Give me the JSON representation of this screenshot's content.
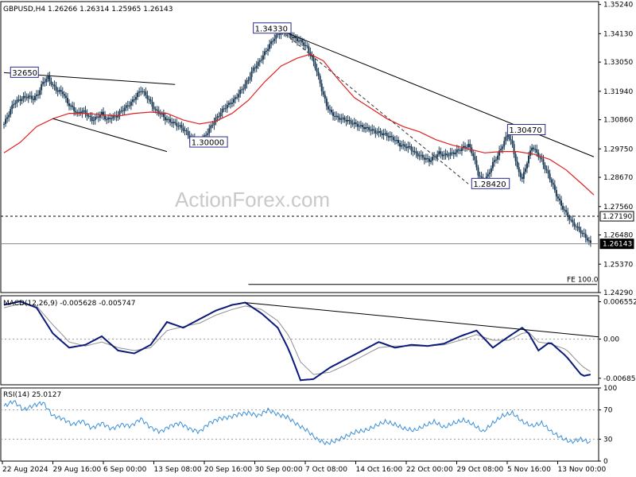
{
  "header": {
    "symbol": "GBPUSD,H4",
    "ohlc": "1.26266 1.26314 1.25965 1.26143"
  },
  "watermark": "ActionForex.com",
  "colors": {
    "candle": "#1b3a55",
    "ema": "#e02020",
    "trendline": "#000000",
    "macd": "#0a1a7a",
    "signal": "#909090",
    "rsi": "#3a8fd8",
    "grid": "#999999"
  },
  "chart_data": [
    {
      "type": "line",
      "name": "price",
      "title": "GBPUSD,H4",
      "ylim": [
        1.2429,
        1.3535
      ],
      "y_ticks": [
        "1.35240",
        "1.34130",
        "1.33050",
        "1.31940",
        "1.30860",
        "1.29750",
        "1.28670",
        "1.27560",
        "1.26480",
        "1.25370",
        "1.24290"
      ],
      "x_ticks": [
        "22 Aug 2024",
        "29 Aug 16:00",
        "6 Sep 00:00",
        "13 Sep 08:00",
        "20 Sep 16:00",
        "30 Sep 00:00",
        "7 Oct 08:00",
        "14 Oct 16:00",
        "22 Oct 00:00",
        "29 Oct 08:00",
        "5 Nov 16:00",
        "13 Nov 00:00"
      ],
      "close_series": [
        [
          0,
          1.307
        ],
        [
          3,
          1.311
        ],
        [
          6,
          1.315
        ],
        [
          9,
          1.316
        ],
        [
          12,
          1.317
        ],
        [
          15,
          1.3175
        ],
        [
          18,
          1.3165
        ],
        [
          21,
          1.3185
        ],
        [
          24,
          1.323
        ],
        [
          27,
          1.3245
        ],
        [
          30,
          1.3215
        ],
        [
          33,
          1.3195
        ],
        [
          36,
          1.319
        ],
        [
          39,
          1.315
        ],
        [
          42,
          1.313
        ],
        [
          45,
          1.311
        ],
        [
          48,
          1.312
        ],
        [
          51,
          1.3105
        ],
        [
          54,
          1.3085
        ],
        [
          57,
          1.3095
        ],
        [
          60,
          1.311
        ],
        [
          63,
          1.3085
        ],
        [
          66,
          1.3095
        ],
        [
          69,
          1.31
        ],
        [
          72,
          1.312
        ],
        [
          75,
          1.3135
        ],
        [
          78,
          1.315
        ],
        [
          81,
          1.3175
        ],
        [
          84,
          1.32
        ],
        [
          87,
          1.318
        ],
        [
          90,
          1.315
        ],
        [
          93,
          1.312
        ],
        [
          96,
          1.311
        ],
        [
          99,
          1.309
        ],
        [
          102,
          1.308
        ],
        [
          105,
          1.307
        ],
        [
          108,
          1.306
        ],
        [
          111,
          1.3045
        ],
        [
          114,
          1.302
        ],
        [
          117,
          1.301
        ],
        [
          120,
          1.3
        ],
        [
          123,
          1.302
        ],
        [
          126,
          1.305
        ],
        [
          129,
          1.308
        ],
        [
          132,
          1.3105
        ],
        [
          135,
          1.313
        ],
        [
          138,
          1.3145
        ],
        [
          141,
          1.316
        ],
        [
          144,
          1.3185
        ],
        [
          147,
          1.321
        ],
        [
          150,
          1.324
        ],
        [
          153,
          1.328
        ],
        [
          156,
          1.33
        ],
        [
          159,
          1.333
        ],
        [
          162,
          1.336
        ],
        [
          165,
          1.339
        ],
        [
          168,
          1.341
        ],
        [
          171,
          1.3425
        ],
        [
          174,
          1.3415
        ],
        [
          177,
          1.34
        ],
        [
          180,
          1.339
        ],
        [
          183,
          1.338
        ],
        [
          186,
          1.336
        ],
        [
          189,
          1.332
        ],
        [
          192,
          1.327
        ],
        [
          195,
          1.32
        ],
        [
          198,
          1.314
        ],
        [
          201,
          1.311
        ],
        [
          204,
          1.3095
        ],
        [
          207,
          1.309
        ],
        [
          210,
          1.3085
        ],
        [
          213,
          1.3075
        ],
        [
          216,
          1.3068
        ],
        [
          219,
          1.306
        ],
        [
          222,
          1.3055
        ],
        [
          225,
          1.3048
        ],
        [
          228,
          1.304
        ],
        [
          231,
          1.3035
        ],
        [
          234,
          1.303
        ],
        [
          237,
          1.302
        ],
        [
          240,
          1.301
        ],
        [
          243,
          1.299
        ],
        [
          246,
          1.2985
        ],
        [
          249,
          1.298
        ],
        [
          252,
          1.296
        ],
        [
          255,
          1.295
        ],
        [
          258,
          1.294
        ],
        [
          261,
          1.293
        ],
        [
          264,
          1.2945
        ],
        [
          267,
          1.296
        ],
        [
          270,
          1.295
        ],
        [
          273,
          1.2955
        ],
        [
          276,
          1.296
        ],
        [
          279,
          1.297
        ],
        [
          282,
          1.298
        ],
        [
          285,
          1.299
        ],
        [
          288,
          1.295
        ],
        [
          291,
          1.288
        ],
        [
          294,
          1.285
        ],
        [
          297,
          1.2875
        ],
        [
          300,
          1.292
        ],
        [
          303,
          1.295
        ],
        [
          306,
          1.299
        ],
        [
          309,
          1.303
        ],
        [
          312,
          1.299
        ],
        [
          315,
          1.29
        ],
        [
          318,
          1.286
        ],
        [
          321,
          1.2925
        ],
        [
          324,
          1.2985
        ],
        [
          327,
          1.296
        ],
        [
          330,
          1.293
        ],
        [
          333,
          1.289
        ],
        [
          336,
          1.285
        ],
        [
          339,
          1.28
        ],
        [
          342,
          1.276
        ],
        [
          345,
          1.273
        ],
        [
          348,
          1.27
        ],
        [
          351,
          1.268
        ],
        [
          354,
          1.266
        ],
        [
          357,
          1.264
        ],
        [
          360,
          1.2614
        ]
      ],
      "ema_series": [
        [
          0,
          1.296
        ],
        [
          10,
          1.3
        ],
        [
          20,
          1.306
        ],
        [
          30,
          1.309
        ],
        [
          40,
          1.311
        ],
        [
          50,
          1.311
        ],
        [
          60,
          1.3105
        ],
        [
          70,
          1.31
        ],
        [
          80,
          1.311
        ],
        [
          90,
          1.3115
        ],
        [
          100,
          1.311
        ],
        [
          110,
          1.3085
        ],
        [
          120,
          1.307
        ],
        [
          130,
          1.308
        ],
        [
          140,
          1.311
        ],
        [
          150,
          1.316
        ],
        [
          160,
          1.323
        ],
        [
          170,
          1.329
        ],
        [
          180,
          1.332
        ],
        [
          188,
          1.3335
        ],
        [
          196,
          1.331
        ],
        [
          205,
          1.324
        ],
        [
          215,
          1.317
        ],
        [
          225,
          1.313
        ],
        [
          235,
          1.309
        ],
        [
          245,
          1.306
        ],
        [
          255,
          1.304
        ],
        [
          265,
          1.301
        ],
        [
          275,
          1.299
        ],
        [
          285,
          1.2975
        ],
        [
          295,
          1.296
        ],
        [
          305,
          1.2965
        ],
        [
          315,
          1.2965
        ],
        [
          325,
          1.2955
        ],
        [
          335,
          1.2935
        ],
        [
          345,
          1.2895
        ],
        [
          355,
          1.284
        ],
        [
          362,
          1.28
        ]
      ],
      "labels": [
        {
          "text": "32650",
          "x": 5,
          "y": 1.3265
        },
        {
          "text": "1.34330",
          "x": 154,
          "y": 1.3433
        },
        {
          "text": "1.30000",
          "x": 115,
          "y": 1.3
        },
        {
          "text": "1.28420",
          "x": 288,
          "y": 1.2842
        },
        {
          "text": "1.30470",
          "x": 310,
          "y": 1.3047
        }
      ],
      "levels": [
        {
          "label": "1.27190",
          "value": 1.2719
        },
        {
          "label": "1.26143",
          "value": 1.26143
        }
      ],
      "fe_label": "FE 100.0",
      "fe_value": 1.246
    },
    {
      "type": "line",
      "name": "MACD",
      "title": "MACD(12,26,9) -0.005628 -0.005747",
      "ylim": [
        -0.008,
        0.0076
      ],
      "y_ticks": [
        "0.006552",
        "0.00",
        "-0.006855"
      ],
      "macd_series": [
        [
          0,
          0.006
        ],
        [
          10,
          0.0066
        ],
        [
          20,
          0.0055
        ],
        [
          30,
          0.001
        ],
        [
          40,
          -0.0015
        ],
        [
          50,
          -0.001
        ],
        [
          60,
          0.0005
        ],
        [
          70,
          -0.002
        ],
        [
          80,
          -0.0025
        ],
        [
          90,
          -0.001
        ],
        [
          100,
          0.003
        ],
        [
          110,
          0.002
        ],
        [
          120,
          0.0035
        ],
        [
          130,
          0.005
        ],
        [
          140,
          0.006
        ],
        [
          148,
          0.0064
        ],
        [
          158,
          0.0045
        ],
        [
          168,
          0.002
        ],
        [
          175,
          -0.002
        ],
        [
          182,
          -0.0072
        ],
        [
          190,
          -0.007
        ],
        [
          200,
          -0.005
        ],
        [
          210,
          -0.0035
        ],
        [
          220,
          -0.002
        ],
        [
          230,
          -0.0005
        ],
        [
          240,
          -0.0015
        ],
        [
          250,
          -0.001
        ],
        [
          260,
          -0.0012
        ],
        [
          270,
          -0.0008
        ],
        [
          280,
          0.0005
        ],
        [
          290,
          0.0015
        ],
        [
          300,
          -0.0015
        ],
        [
          310,
          0.0005
        ],
        [
          318,
          0.002
        ],
        [
          322,
          0.001
        ],
        [
          328,
          -0.002
        ],
        [
          335,
          -0.0005
        ],
        [
          345,
          -0.003
        ],
        [
          355,
          -0.0065
        ],
        [
          360,
          -0.0062
        ]
      ],
      "signal_series": [
        [
          0,
          0.0055
        ],
        [
          10,
          0.0062
        ],
        [
          20,
          0.0058
        ],
        [
          30,
          0.0025
        ],
        [
          40,
          -0.0005
        ],
        [
          50,
          -0.0012
        ],
        [
          60,
          -0.0005
        ],
        [
          70,
          -0.0015
        ],
        [
          80,
          -0.002
        ],
        [
          90,
          -0.0015
        ],
        [
          100,
          0.0015
        ],
        [
          110,
          0.0022
        ],
        [
          120,
          0.0028
        ],
        [
          130,
          0.0042
        ],
        [
          140,
          0.0052
        ],
        [
          148,
          0.0058
        ],
        [
          158,
          0.0052
        ],
        [
          168,
          0.0032
        ],
        [
          175,
          0.0005
        ],
        [
          182,
          -0.004
        ],
        [
          190,
          -0.0062
        ],
        [
          200,
          -0.0058
        ],
        [
          210,
          -0.0045
        ],
        [
          220,
          -0.003
        ],
        [
          230,
          -0.0015
        ],
        [
          240,
          -0.0012
        ],
        [
          250,
          -0.0012
        ],
        [
          260,
          -0.0012
        ],
        [
          270,
          -0.001
        ],
        [
          280,
          -0.0002
        ],
        [
          290,
          0.0008
        ],
        [
          300,
          -0.0002
        ],
        [
          310,
          -0.0002
        ],
        [
          318,
          0.001
        ],
        [
          322,
          0.0012
        ],
        [
          328,
          -0.0005
        ],
        [
          335,
          -0.0008
        ],
        [
          345,
          -0.0018
        ],
        [
          355,
          -0.0048
        ],
        [
          360,
          -0.0057
        ]
      ]
    },
    {
      "type": "line",
      "name": "RSI",
      "title": "RSI(14) 25.0127",
      "ylim": [
        0,
        100
      ],
      "y_ticks": [
        "100",
        "70",
        "30",
        "0"
      ],
      "levels": [
        70,
        30
      ],
      "rsi_series": [
        [
          0,
          75
        ],
        [
          6,
          82
        ],
        [
          12,
          70
        ],
        [
          18,
          76
        ],
        [
          24,
          80
        ],
        [
          30,
          62
        ],
        [
          36,
          58
        ],
        [
          42,
          50
        ],
        [
          48,
          55
        ],
        [
          54,
          45
        ],
        [
          60,
          52
        ],
        [
          66,
          44
        ],
        [
          72,
          50
        ],
        [
          78,
          48
        ],
        [
          84,
          58
        ],
        [
          90,
          46
        ],
        [
          96,
          40
        ],
        [
          102,
          48
        ],
        [
          108,
          52
        ],
        [
          114,
          44
        ],
        [
          120,
          40
        ],
        [
          126,
          52
        ],
        [
          132,
          58
        ],
        [
          138,
          60
        ],
        [
          144,
          64
        ],
        [
          150,
          66
        ],
        [
          156,
          62
        ],
        [
          162,
          70
        ],
        [
          168,
          64
        ],
        [
          174,
          60
        ],
        [
          180,
          50
        ],
        [
          186,
          42
        ],
        [
          192,
          30
        ],
        [
          198,
          24
        ],
        [
          204,
          28
        ],
        [
          210,
          34
        ],
        [
          216,
          40
        ],
        [
          222,
          42
        ],
        [
          228,
          48
        ],
        [
          234,
          54
        ],
        [
          240,
          50
        ],
        [
          246,
          44
        ],
        [
          252,
          42
        ],
        [
          258,
          48
        ],
        [
          264,
          54
        ],
        [
          270,
          46
        ],
        [
          276,
          52
        ],
        [
          282,
          56
        ],
        [
          288,
          50
        ],
        [
          294,
          40
        ],
        [
          300,
          52
        ],
        [
          306,
          62
        ],
        [
          312,
          66
        ],
        [
          318,
          54
        ],
        [
          324,
          48
        ],
        [
          330,
          52
        ],
        [
          336,
          40
        ],
        [
          342,
          32
        ],
        [
          348,
          26
        ],
        [
          354,
          30
        ],
        [
          360,
          25
        ]
      ]
    }
  ]
}
